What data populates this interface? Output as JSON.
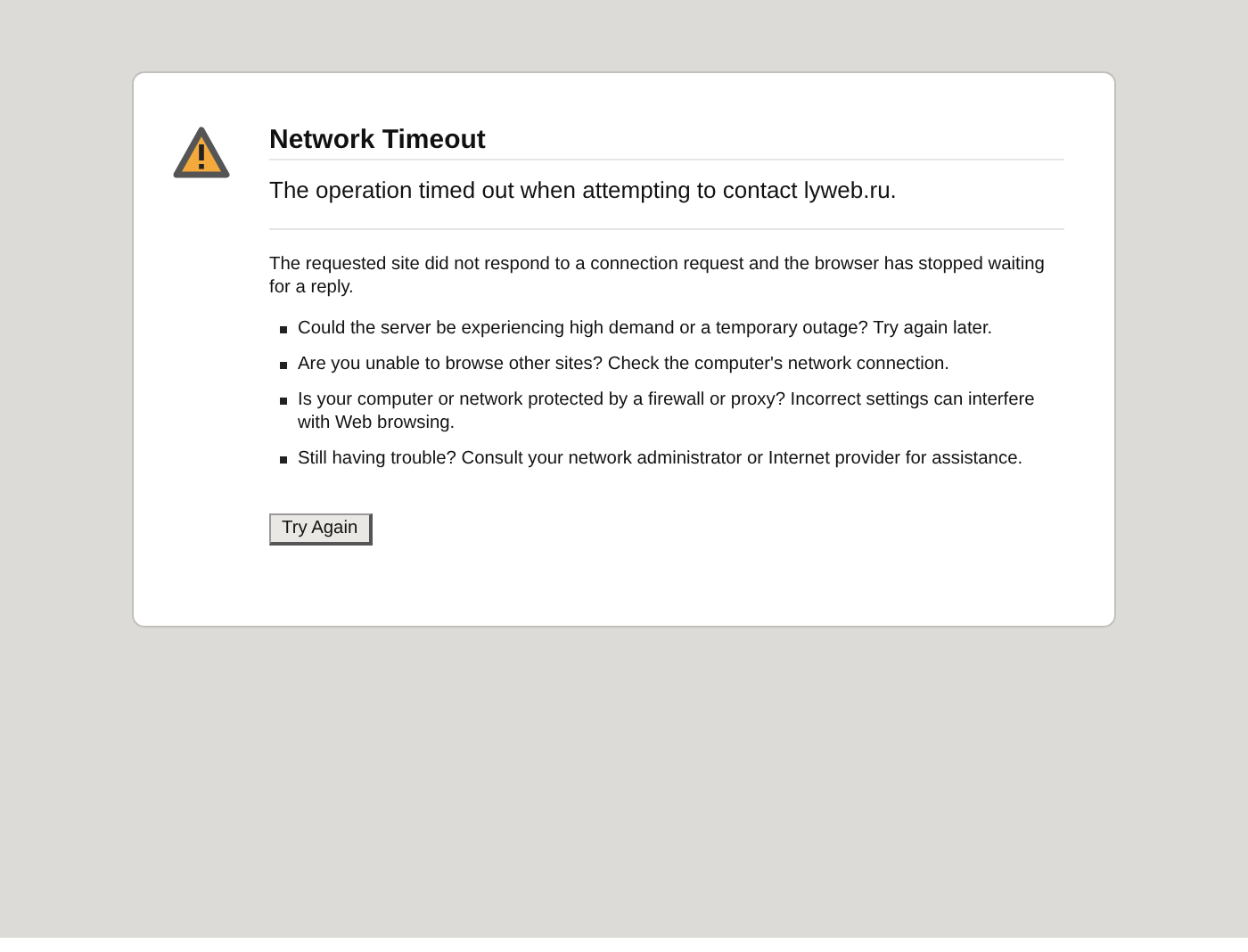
{
  "title": "Network Timeout",
  "short_description": "The operation timed out when attempting to contact lyweb.ru.",
  "long_description": "The requested site did not respond to a connection request and the browser has stopped waiting for a reply.",
  "suggestions": [
    "Could the server be experiencing high demand or a temporary outage? Try again later.",
    "Are you unable to browse other sites? Check the computer's network connection.",
    "Is your computer or network protected by a firewall or proxy? Incorrect settings can interfere with Web browsing.",
    "Still having trouble? Consult your network administrator or Internet provider for assistance."
  ],
  "button": "Try Again"
}
